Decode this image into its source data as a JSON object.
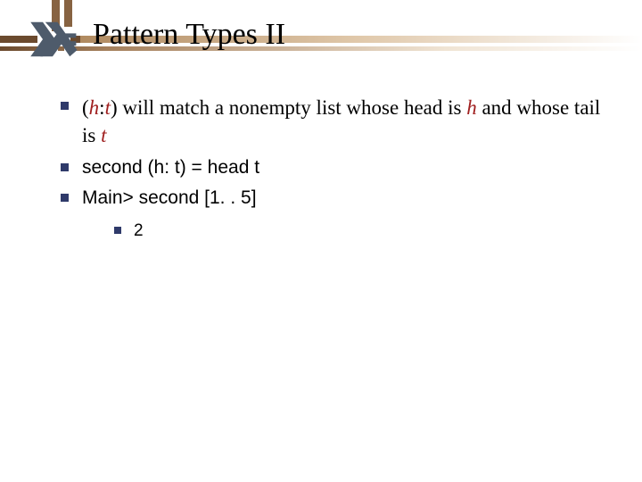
{
  "title": "Pattern Types II",
  "bullets": {
    "b1": {
      "p_open": "(",
      "h": "h",
      "colon": ":",
      "t": "t",
      "p_close": ")",
      "text_mid": " will match a nonempty list whose head is ",
      "h2": "h",
      "text_and": " and whose tail is ",
      "t2": "t"
    },
    "b2": "second (h: t) = head t",
    "b3": "Main> second [1. . 5]",
    "sub1": "2"
  }
}
